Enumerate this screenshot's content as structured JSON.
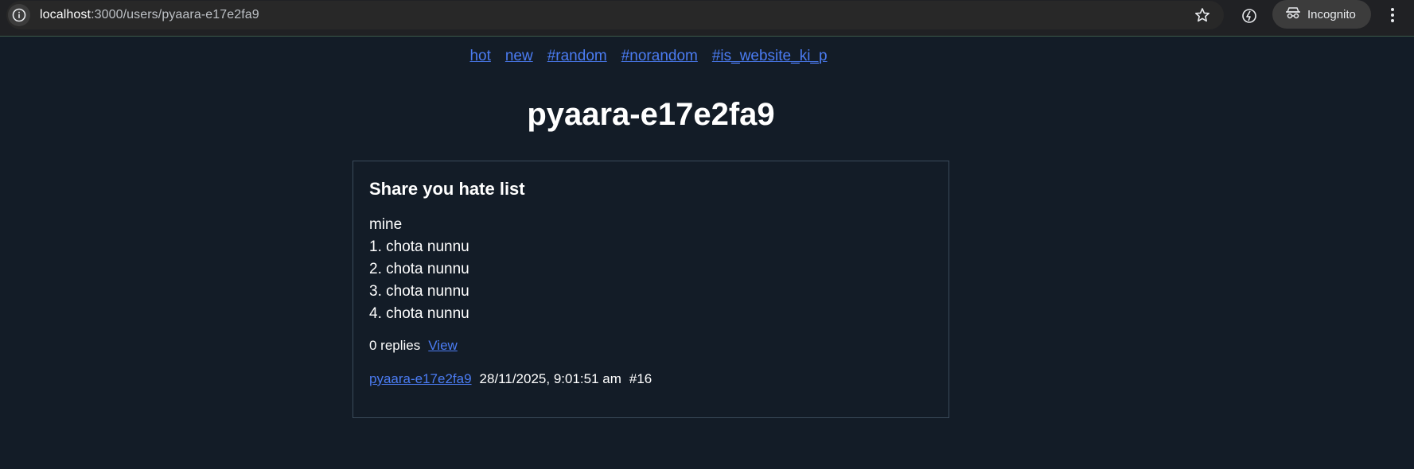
{
  "browser": {
    "url_host": "localhost",
    "url_path": ":3000/users/pyaara-e17e2fa9",
    "incognito_label": "Incognito"
  },
  "nav": {
    "items": [
      {
        "label": "hot"
      },
      {
        "label": "new"
      },
      {
        "label": "#random"
      },
      {
        "label": "#norandom"
      },
      {
        "label": "#is_website_ki_p"
      }
    ]
  },
  "page": {
    "title": "pyaara-e17e2fa9"
  },
  "post": {
    "title": "Share you hate list",
    "body_lines": [
      "mine",
      "1. chota nunnu",
      "2. chota nunnu",
      "3. chota nunnu",
      "4. chota nunnu"
    ],
    "replies_text": "0 replies",
    "view_label": "View",
    "author": "pyaara-e17e2fa9",
    "timestamp": "28/11/2025, 9:01:51 am",
    "post_id": "#16"
  },
  "colors": {
    "background": "#131c27",
    "link": "#4b7cf3",
    "card_border": "#3a4a5a"
  }
}
